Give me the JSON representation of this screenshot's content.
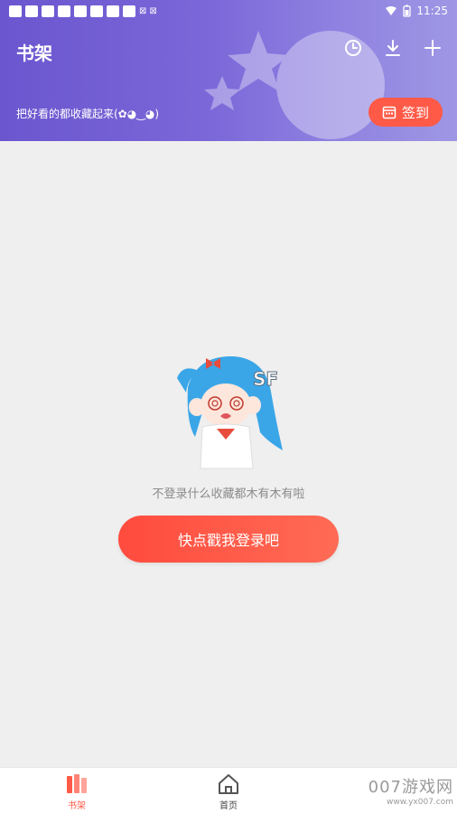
{
  "status_bar": {
    "time": "11:25",
    "battery_icon": "battery-icon",
    "wifi_icon": "wifi-icon",
    "extra": "⊠ ⊠"
  },
  "header": {
    "title": "书架",
    "subtitle": "把好看的都收藏起来(✿◕‿◕)",
    "checkin_label": "签到",
    "icons": [
      "history-icon",
      "download-icon",
      "add-icon"
    ]
  },
  "empty_state": {
    "message": "不登录什么收藏都木有木有啦",
    "login_button": "快点戳我登录吧"
  },
  "bottom_nav": {
    "items": [
      {
        "label": "书架",
        "icon": "bookshelf-icon",
        "active": true
      },
      {
        "label": "首页",
        "icon": "home-icon",
        "active": false
      }
    ]
  },
  "watermark": {
    "line1": "007游戏网",
    "line2": "www.yx007.com"
  },
  "colors": {
    "accent": "#ff5a47",
    "header_start": "#6b56cf",
    "header_end": "#9f97e4",
    "background": "#efefef"
  }
}
